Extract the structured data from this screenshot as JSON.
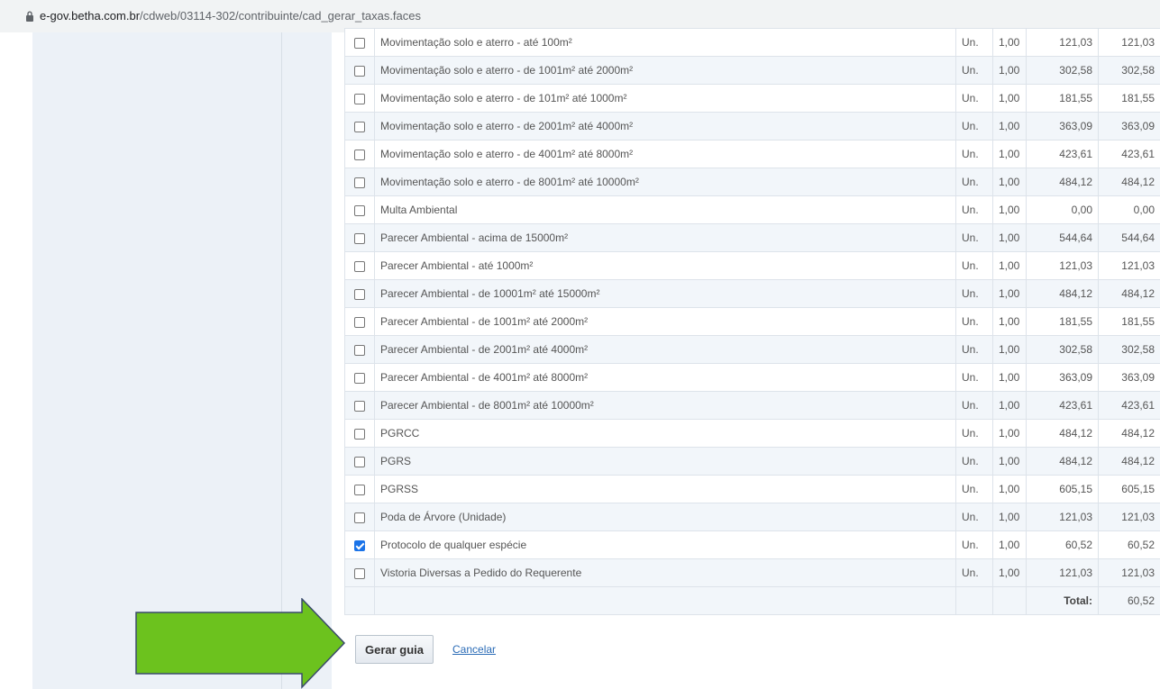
{
  "browser": {
    "url_host": "e-gov.betha.com.br",
    "url_path": "/cdweb/03114-302/contribuinte/cad_gerar_taxas.faces"
  },
  "taxas": [
    {
      "checked": false,
      "descricao": "Movimentação solo e aterro - até 100m²",
      "un": "Un.",
      "qtd": "1,00",
      "valor": "121,03",
      "total": "121,03"
    },
    {
      "checked": false,
      "descricao": "Movimentação solo e aterro - de 1001m² até 2000m²",
      "un": "Un.",
      "qtd": "1,00",
      "valor": "302,58",
      "total": "302,58"
    },
    {
      "checked": false,
      "descricao": "Movimentação solo e aterro - de 101m² até 1000m²",
      "un": "Un.",
      "qtd": "1,00",
      "valor": "181,55",
      "total": "181,55"
    },
    {
      "checked": false,
      "descricao": "Movimentação solo e aterro - de 2001m² até 4000m²",
      "un": "Un.",
      "qtd": "1,00",
      "valor": "363,09",
      "total": "363,09"
    },
    {
      "checked": false,
      "descricao": "Movimentação solo e aterro - de 4001m² até 8000m²",
      "un": "Un.",
      "qtd": "1,00",
      "valor": "423,61",
      "total": "423,61"
    },
    {
      "checked": false,
      "descricao": "Movimentação solo e aterro - de 8001m² até 10000m²",
      "un": "Un.",
      "qtd": "1,00",
      "valor": "484,12",
      "total": "484,12"
    },
    {
      "checked": false,
      "descricao": "Multa Ambiental",
      "un": "Un.",
      "qtd": "1,00",
      "valor": "0,00",
      "total": "0,00"
    },
    {
      "checked": false,
      "descricao": "Parecer Ambiental - acima de 15000m²",
      "un": "Un.",
      "qtd": "1,00",
      "valor": "544,64",
      "total": "544,64"
    },
    {
      "checked": false,
      "descricao": "Parecer Ambiental - até 1000m²",
      "un": "Un.",
      "qtd": "1,00",
      "valor": "121,03",
      "total": "121,03"
    },
    {
      "checked": false,
      "descricao": "Parecer Ambiental - de 10001m² até 15000m²",
      "un": "Un.",
      "qtd": "1,00",
      "valor": "484,12",
      "total": "484,12"
    },
    {
      "checked": false,
      "descricao": "Parecer Ambiental - de 1001m² até 2000m²",
      "un": "Un.",
      "qtd": "1,00",
      "valor": "181,55",
      "total": "181,55"
    },
    {
      "checked": false,
      "descricao": "Parecer Ambiental - de 2001m² até 4000m²",
      "un": "Un.",
      "qtd": "1,00",
      "valor": "302,58",
      "total": "302,58"
    },
    {
      "checked": false,
      "descricao": "Parecer Ambiental - de 4001m² até 8000m²",
      "un": "Un.",
      "qtd": "1,00",
      "valor": "363,09",
      "total": "363,09"
    },
    {
      "checked": false,
      "descricao": "Parecer Ambiental - de 8001m² até 10000m²",
      "un": "Un.",
      "qtd": "1,00",
      "valor": "423,61",
      "total": "423,61"
    },
    {
      "checked": false,
      "descricao": "PGRCC",
      "un": "Un.",
      "qtd": "1,00",
      "valor": "484,12",
      "total": "484,12"
    },
    {
      "checked": false,
      "descricao": "PGRS",
      "un": "Un.",
      "qtd": "1,00",
      "valor": "484,12",
      "total": "484,12"
    },
    {
      "checked": false,
      "descricao": "PGRSS",
      "un": "Un.",
      "qtd": "1,00",
      "valor": "605,15",
      "total": "605,15"
    },
    {
      "checked": false,
      "descricao": "Poda de Árvore (Unidade)",
      "un": "Un.",
      "qtd": "1,00",
      "valor": "121,03",
      "total": "121,03"
    },
    {
      "checked": true,
      "descricao": "Protocolo de qualquer espécie",
      "un": "Un.",
      "qtd": "1,00",
      "valor": "60,52",
      "total": "60,52"
    },
    {
      "checked": false,
      "descricao": "Vistoria Diversas a Pedido do Requerente",
      "un": "Un.",
      "qtd": "1,00",
      "valor": "121,03",
      "total": "121,03"
    }
  ],
  "totais": {
    "label": "Total:",
    "valor": "60,52"
  },
  "acoes": {
    "gerar_label": "Gerar guia",
    "cancelar_label": "Cancelar"
  },
  "colors": {
    "arrow_fill": "#6cc21e",
    "arrow_stroke": "#3a4a6b",
    "checkbox_checked": "#1a73e8",
    "link": "#2a6bb6"
  }
}
